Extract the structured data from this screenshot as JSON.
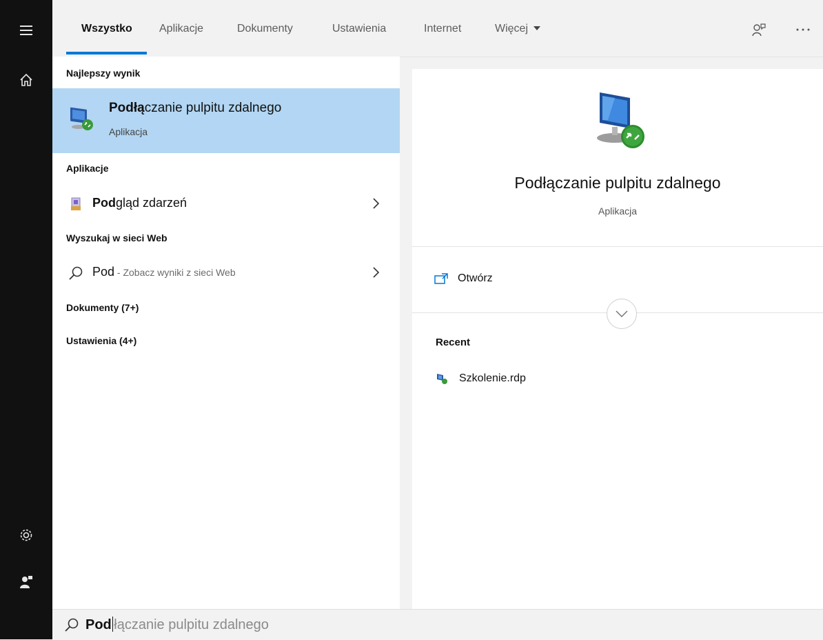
{
  "tabs": [
    {
      "label": "Wszystko",
      "active": true
    },
    {
      "label": "Aplikacje"
    },
    {
      "label": "Dokumenty"
    },
    {
      "label": "Ustawienia"
    },
    {
      "label": "Internet"
    },
    {
      "label": "Więcej"
    }
  ],
  "left": {
    "best_header": "Najlepszy wynik",
    "best_title_bold": "Podłą",
    "best_title_rest": "czanie pulpitu zdalnego",
    "best_sub": "Aplikacja",
    "apps_header": "Aplikacje",
    "app_item_bold": "Pod",
    "app_item_rest": "gląd zdarzeń",
    "web_header": "Wyszukaj w sieci Web",
    "web_item_bold": "Pod",
    "web_item_rest": " - Zobacz wyniki z sieci Web",
    "docs_header": "Dokumenty (7+)",
    "settings_header": "Ustawienia (4+)"
  },
  "right": {
    "title": "Podłączanie pulpitu zdalnego",
    "subtitle": "Aplikacja",
    "action_open": "Otwórz",
    "recent_header": "Recent",
    "recent_item": "Szkolenie.rdp"
  },
  "search": {
    "typed": "Pod",
    "suggestion": "łączanie pulpitu zdalnego"
  },
  "colors": {
    "accent": "#0078d7",
    "selection": "#b2d6f3",
    "rail": "#111111"
  }
}
